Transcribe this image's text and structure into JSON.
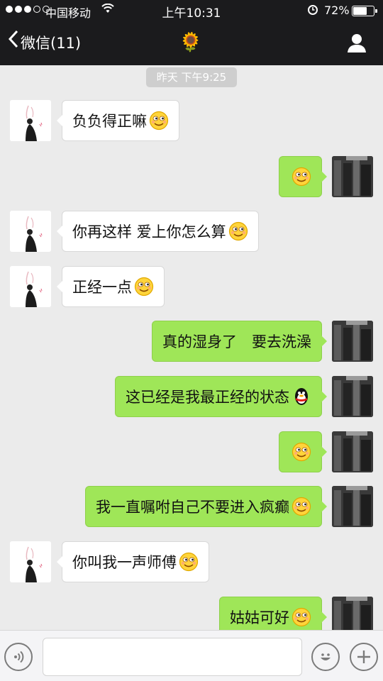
{
  "status_bar": {
    "carrier": "中国移动",
    "time": "上午10:31",
    "battery": "72%",
    "battery_level": 0.72
  },
  "nav": {
    "back_label": "微信(11)",
    "title_icon": "🌻"
  },
  "chat": {
    "timestamp": "昨天 下午9:25",
    "messages": [
      {
        "side": "left",
        "text": "负负得正嘛",
        "emoji": "smirk-face"
      },
      {
        "side": "right",
        "text": "",
        "emoji": "smirk-face"
      },
      {
        "side": "left",
        "text": "你再这样 爱上你怎么算",
        "emoji": "smirk-face"
      },
      {
        "side": "left",
        "text": "正经一点",
        "emoji": "smirk-face"
      },
      {
        "side": "right",
        "text": "真的湿身了　要去洗澡",
        "emoji": ""
      },
      {
        "side": "right",
        "text": "这已经是我最正经的状态",
        "emoji": "penguin-face"
      },
      {
        "side": "right",
        "text": "",
        "emoji": "smirk-face"
      },
      {
        "side": "right",
        "text": "我一直嘱咐自己不要进入疯癫",
        "emoji": "smirk-face"
      },
      {
        "side": "left",
        "text": "你叫我一声师傅",
        "emoji": "smirk-face"
      },
      {
        "side": "right",
        "text": "姑姑可好",
        "emoji": "smirk-face"
      }
    ]
  },
  "input_bar": {
    "placeholder": ""
  }
}
